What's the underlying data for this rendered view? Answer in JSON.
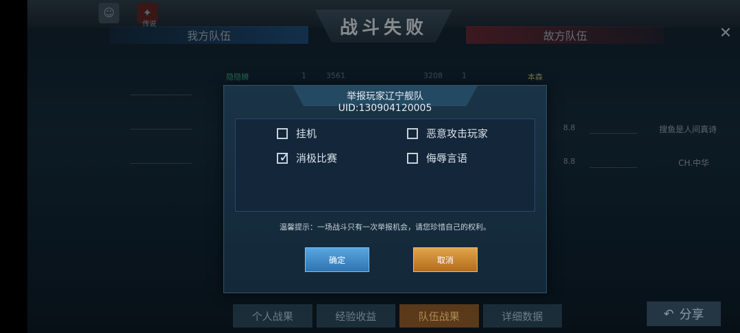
{
  "header": {
    "title": "战斗失败",
    "close_icon": "close-icon",
    "left_icon_label": "",
    "right_icon_label": "传说"
  },
  "teams": {
    "ally_title": "我方队伍",
    "enemy_title": "故方队伍",
    "stats_row": {
      "ally_name": "隐隐狮",
      "ally_count": "1",
      "ally_score": "3561",
      "enemy_score": "3208",
      "enemy_count": "1",
      "enemy_name": "本森"
    },
    "enemy_rows": [
      {
        "name": "搜鱼是人间真诗",
        "score": "8.8"
      },
      {
        "name": "CH.中华",
        "score": "8.8"
      }
    ]
  },
  "dialog": {
    "title": "举报玩家辽宁舰队",
    "uid": "UID:130904120005",
    "options": [
      {
        "label": "挂机",
        "checked": false
      },
      {
        "label": "恶意攻击玩家",
        "checked": false
      },
      {
        "label": "消极比赛",
        "checked": true
      },
      {
        "label": "侮辱言语",
        "checked": false
      }
    ],
    "tip": "温馨提示：一场战斗只有一次举报机会，请您珍惜自己的权利。",
    "confirm_label": "确定",
    "cancel_label": "取消"
  },
  "bottom_tabs": [
    "个人战果",
    "经验收益",
    "队伍战果",
    "详细数据"
  ],
  "active_tab": "队伍战果",
  "share_label": "分享",
  "colors": {
    "confirm": "#3a8cd0",
    "cancel": "#c98a2e",
    "active_tab": "#5a3a1a"
  }
}
